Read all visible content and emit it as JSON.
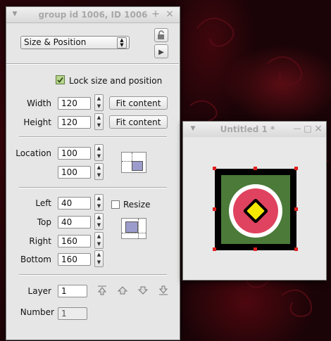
{
  "panel": {
    "title": "group id 1006, ID 1006",
    "buttons": {
      "add": "+",
      "close": "×"
    },
    "mode_select": {
      "value": "Size & Position"
    },
    "lock_checkbox": {
      "label": "Lock size and position",
      "checked": true
    },
    "size": {
      "width_label": "Width",
      "width_value": "120",
      "height_label": "Height",
      "height_value": "120",
      "fit_label": "Fit content"
    },
    "location": {
      "label": "Location",
      "x_value": "100",
      "y_value": "100"
    },
    "rect": {
      "left_label": "Left",
      "left_value": "40",
      "top_label": "Top",
      "top_value": "40",
      "right_label": "Right",
      "right_value": "160",
      "bottom_label": "Bottom",
      "bottom_value": "160",
      "resize_label": "Resize",
      "resize_checked": false
    },
    "layer": {
      "label": "Layer",
      "value": "1"
    },
    "number": {
      "label": "Number",
      "value": "1"
    }
  },
  "document": {
    "title": "Untitled 1 *",
    "buttons": {
      "minimize": "—",
      "maximize": "□",
      "close": "×"
    },
    "colors": {
      "bg": "#4b7a39",
      "border": "#000000",
      "ring": "#e0435f",
      "diamond": "#f5e800",
      "handle": "#e02020"
    }
  }
}
